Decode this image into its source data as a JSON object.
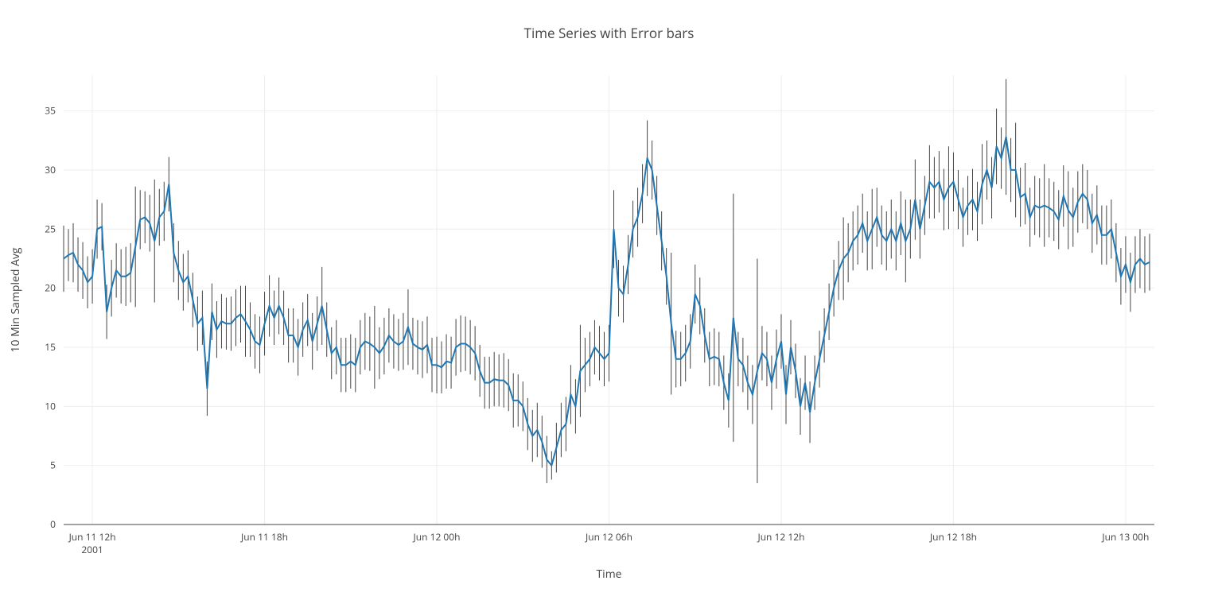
{
  "chart_data": {
    "type": "line",
    "title": "Time Series with Error bars",
    "xlabel": "Time",
    "ylabel": "10 Min Sampled Avg",
    "x_start_label_year": "2001",
    "x_tick_labels": [
      "Jun 11 12h",
      "Jun 11 18h",
      "Jun 12 00h",
      "Jun 12 06h",
      "Jun 12 12h",
      "Jun 12 18h",
      "Jun 13 00h"
    ],
    "x_tick_minutes": [
      0,
      360,
      720,
      1080,
      1440,
      1800,
      2160
    ],
    "y_ticks": [
      0,
      5,
      10,
      15,
      20,
      25,
      30,
      35
    ],
    "ylim": [
      0,
      38
    ],
    "xlim_minutes": [
      -60,
      2220
    ],
    "interval_minutes": 10,
    "first_point_minutes": -60,
    "values": [
      22.5,
      22.8,
      23.0,
      22.0,
      21.5,
      20.5,
      21.0,
      25.0,
      25.2,
      18.0,
      20.0,
      21.5,
      21.0,
      21.0,
      21.3,
      23.5,
      25.8,
      26.0,
      25.5,
      24.0,
      26.0,
      26.5,
      28.8,
      23.0,
      21.5,
      20.5,
      21.0,
      19.0,
      17.0,
      17.5,
      11.5,
      18.0,
      16.5,
      17.2,
      17.0,
      17.0,
      17.5,
      17.8,
      17.2,
      16.5,
      15.5,
      15.2,
      17.0,
      18.5,
      17.5,
      18.5,
      17.5,
      16.0,
      16.0,
      15.0,
      16.5,
      17.3,
      15.5,
      17.0,
      18.5,
      16.5,
      14.5,
      15.0,
      13.5,
      13.5,
      13.8,
      13.5,
      15.0,
      15.5,
      15.3,
      15.0,
      14.5,
      15.1,
      16.0,
      15.5,
      15.2,
      15.5,
      16.7,
      15.3,
      15.0,
      14.8,
      15.2,
      13.5,
      13.5,
      13.3,
      13.8,
      13.7,
      15.0,
      15.3,
      15.3,
      15.0,
      14.5,
      13.0,
      12.0,
      12.0,
      12.3,
      12.2,
      12.2,
      11.8,
      10.5,
      10.5,
      10.0,
      8.5,
      7.5,
      8.0,
      7.0,
      5.5,
      5.0,
      6.5,
      8.0,
      8.5,
      11.0,
      10.0,
      13.0,
      13.5,
      14.0,
      15.0,
      14.5,
      14.0,
      14.5,
      25.0,
      20.0,
      19.5,
      22.0,
      25.0,
      26.0,
      28.0,
      31.0,
      30.0,
      27.0,
      24.0,
      21.0,
      17.0,
      14.0,
      14.0,
      14.5,
      15.5,
      19.5,
      18.5,
      16.0,
      14.0,
      14.2,
      14.0,
      12.0,
      10.5,
      17.5,
      14.0,
      13.5,
      12.0,
      11.0,
      13.0,
      14.5,
      14.0,
      12.0,
      14.0,
      15.5,
      11.0,
      15.0,
      13.0,
      10.0,
      12.0,
      9.5,
      12.0,
      14.0,
      16.0,
      18.0,
      20.0,
      21.5,
      22.5,
      23.0,
      24.0,
      24.5,
      25.5,
      24.0,
      25.0,
      26.0,
      24.5,
      24.0,
      25.0,
      24.0,
      25.5,
      24.0,
      25.0,
      27.5,
      25.0,
      27.0,
      29.0,
      28.5,
      29.0,
      27.5,
      28.5,
      29.0,
      27.5,
      26.0,
      27.0,
      27.5,
      26.5,
      28.8,
      30.0,
      28.5,
      32.0,
      31.0,
      32.8,
      30.0,
      30.0,
      27.7,
      28.0,
      26.0,
      27.0,
      26.8,
      27.0,
      26.8,
      26.5,
      25.8,
      27.8,
      26.6,
      26.0,
      27.3,
      28.0,
      27.5,
      25.5,
      26.2,
      24.5,
      24.5,
      25.0,
      23.0,
      21.0,
      22.0,
      20.5,
      22.0,
      22.5,
      22.0,
      22.2
    ],
    "err": [
      2.8,
      2.2,
      2.5,
      2.3,
      2.4,
      2.2,
      2.3,
      2.5,
      2.0,
      2.3,
      2.4,
      2.3,
      2.3,
      2.5,
      2.5,
      5.1,
      2.5,
      2.2,
      2.4,
      5.2,
      2.4,
      2.5,
      2.3,
      2.5,
      2.5,
      2.4,
      2.2,
      2.3,
      2.3,
      2.3,
      2.3,
      2.4,
      2.4,
      2.3,
      2.2,
      2.3,
      2.4,
      2.4,
      3.0,
      2.3,
      2.3,
      2.4,
      2.7,
      2.6,
      2.3,
      2.4,
      2.3,
      2.3,
      2.3,
      2.4,
      2.3,
      2.2,
      2.4,
      2.3,
      3.3,
      2.3,
      2.2,
      2.3,
      2.3,
      2.3,
      2.3,
      2.3,
      2.3,
      2.4,
      2.3,
      3.5,
      2.2,
      2.4,
      2.3,
      2.3,
      2.2,
      2.4,
      3.2,
      2.2,
      2.3,
      2.4,
      2.4,
      2.3,
      2.4,
      2.2,
      2.3,
      2.2,
      2.4,
      2.4,
      2.3,
      2.3,
      2.3,
      2.2,
      2.2,
      2.2,
      2.3,
      2.2,
      2.3,
      2.2,
      2.3,
      2.2,
      2.1,
      2.2,
      2.2,
      2.3,
      2.2,
      2.0,
      1.2,
      2.1,
      2.3,
      2.3,
      2.5,
      2.3,
      3.9,
      2.3,
      2.3,
      2.3,
      2.3,
      2.3,
      2.4,
      3.3,
      2.4,
      2.4,
      2.5,
      2.4,
      2.5,
      2.5,
      3.2,
      2.5,
      2.5,
      2.5,
      2.4,
      6.0,
      2.4,
      2.3,
      2.4,
      2.3,
      2.5,
      2.4,
      2.3,
      2.3,
      2.4,
      2.3,
      2.3,
      2.3,
      10.5,
      2.3,
      2.3,
      2.3,
      2.5,
      9.5,
      2.3,
      2.3,
      2.3,
      2.5,
      2.3,
      2.5,
      2.3,
      2.3,
      2.4,
      2.3,
      2.6,
      2.3,
      2.4,
      2.3,
      2.4,
      2.4,
      2.5,
      3.5,
      2.5,
      2.5,
      2.5,
      2.5,
      2.5,
      3.4,
      2.5,
      2.5,
      2.5,
      2.5,
      2.5,
      2.7,
      3.5,
      2.5,
      3.4,
      2.5,
      2.5,
      3.1,
      2.6,
      2.6,
      2.6,
      3.5,
      2.5,
      2.5,
      2.5,
      2.5,
      2.6,
      2.5,
      3.4,
      2.5,
      2.6,
      3.2,
      2.6,
      4.9,
      2.7,
      4.0,
      2.5,
      2.6,
      2.5,
      2.5,
      2.5,
      3.5,
      2.5,
      2.5,
      2.5,
      2.6,
      3.3,
      2.5,
      2.6,
      2.5,
      2.5,
      2.5,
      2.5,
      2.5,
      2.5,
      2.5,
      2.5,
      2.4,
      2.4,
      2.5,
      2.4,
      2.5,
      2.4,
      2.4
    ]
  }
}
